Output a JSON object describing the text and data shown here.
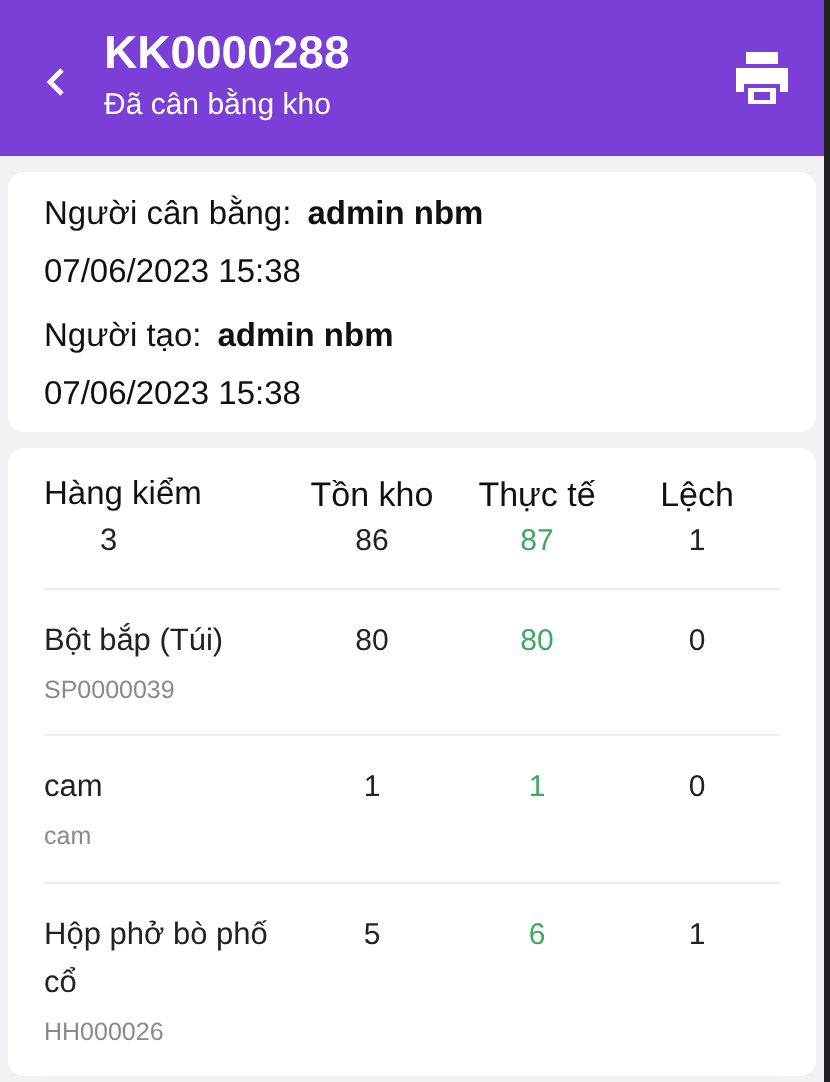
{
  "header": {
    "title": "KK0000288",
    "subtitle": "Đã cân bằng kho"
  },
  "info": [
    {
      "label": "Người cân bằng:",
      "value": "admin nbm",
      "date": "07/06/2023 15:38"
    },
    {
      "label": "Người tạo:",
      "value": "admin nbm",
      "date": "07/06/2023 15:38"
    }
  ],
  "table": {
    "columns": [
      "Hàng kiểm",
      "Tồn kho",
      "Thực tế",
      "Lệch"
    ],
    "totals": [
      "3",
      "86",
      "87",
      "1"
    ],
    "rows": [
      {
        "name": "Bột bắp (Túi)",
        "code": "SP0000039",
        "stock": "80",
        "actual": "80",
        "diff": "0"
      },
      {
        "name": "cam",
        "code": "cam",
        "stock": "1",
        "actual": "1",
        "diff": "0"
      },
      {
        "name": "Hộp phở bò phố cổ",
        "code": "HH000026",
        "stock": "5",
        "actual": "6",
        "diff": "1"
      }
    ]
  }
}
